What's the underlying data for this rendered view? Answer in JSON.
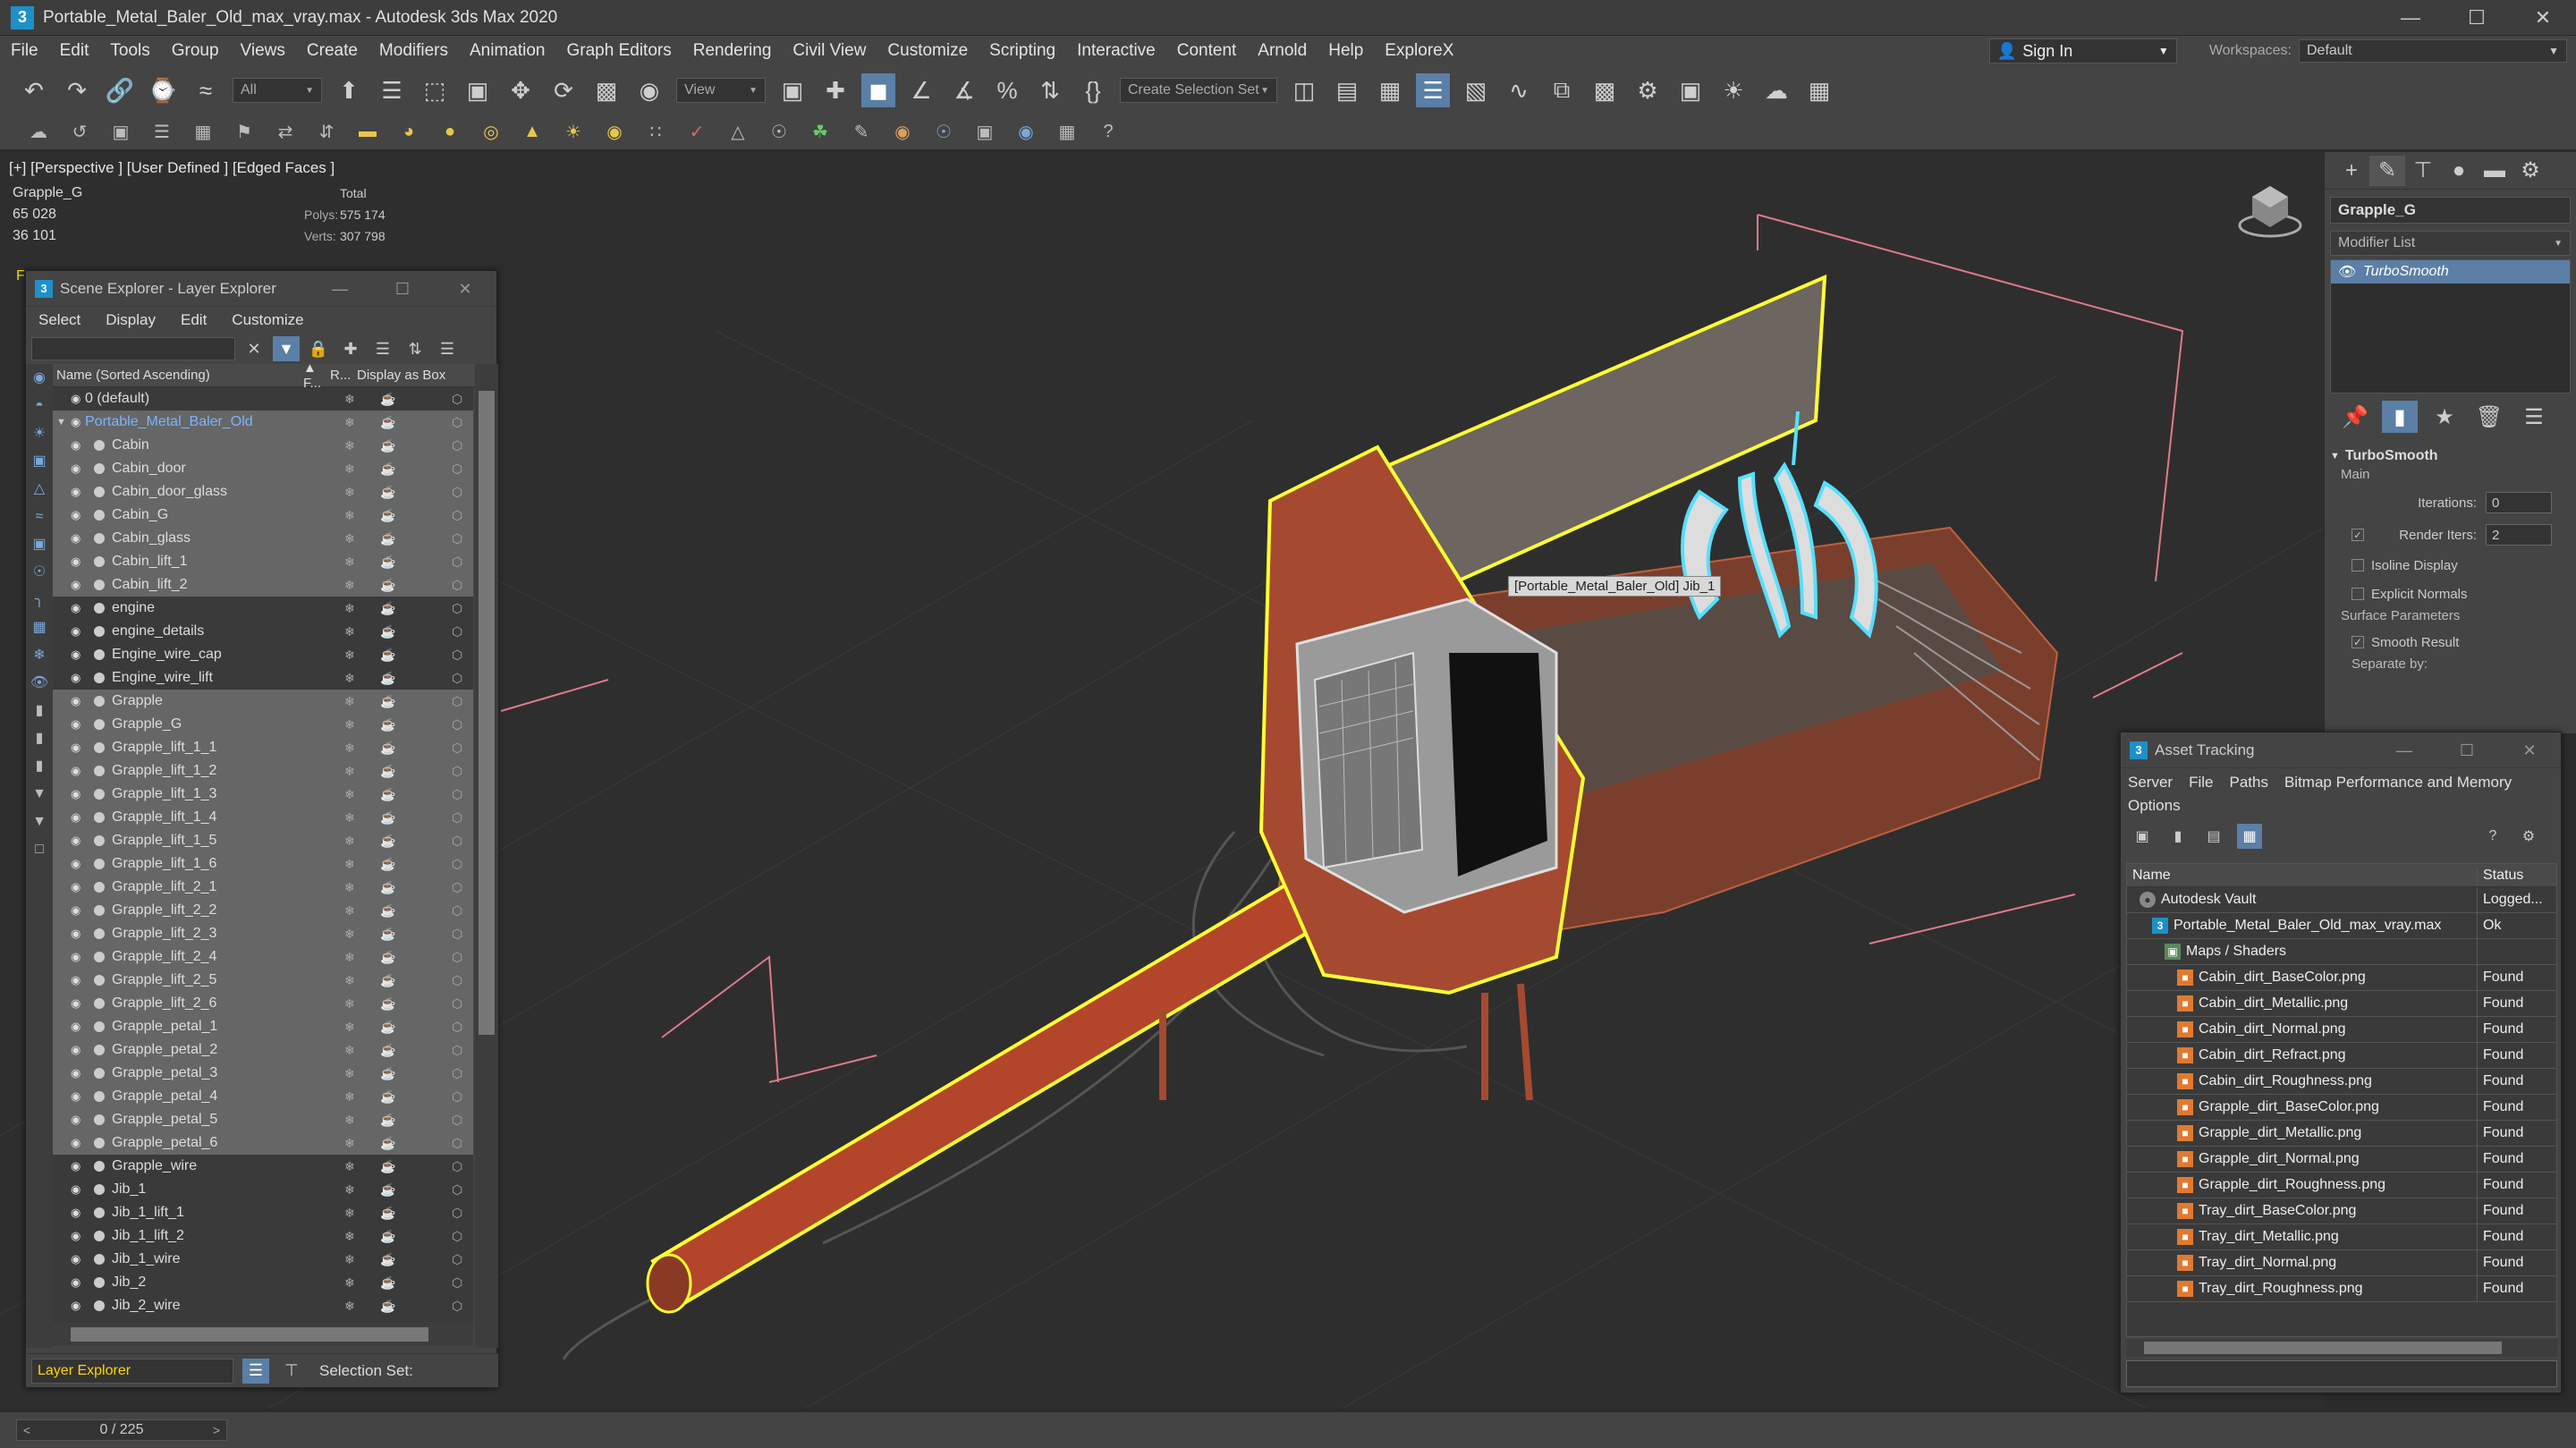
{
  "window": {
    "title": "Portable_Metal_Baler_Old_max_vray.max - Autodesk 3ds Max 2020",
    "app_icon": "3",
    "minimize_icon": "minimize-icon",
    "maximize_icon": "maximize-icon",
    "close_icon": "close-icon"
  },
  "menubar": {
    "items": [
      "File",
      "Edit",
      "Tools",
      "Group",
      "Views",
      "Create",
      "Modifiers",
      "Animation",
      "Graph Editors",
      "Rendering",
      "Civil View",
      "Customize",
      "Scripting",
      "Interactive",
      "Content",
      "Arnold",
      "Help",
      "ExploreX"
    ],
    "sign_in": "Sign In",
    "workspaces_label": "Workspaces:",
    "workspaces_value": "Default"
  },
  "toolbar": {
    "filter_all": "All",
    "ref_coord": "View",
    "selection_set": "Create Selection Set"
  },
  "viewport": {
    "label": "[+] [Perspective ] [User Defined ] [Edged Faces ]",
    "stats": {
      "col_total": "Total",
      "col_object": "Grapple_G",
      "polys_label": "Polys:",
      "polys_total": "575 174",
      "polys_object": "65 028",
      "verts_label": "Verts:",
      "verts_total": "307 798",
      "verts_object": "36 101"
    },
    "tooltip": "[Portable_Metal_Baler_Old] Jib_1",
    "edge_marker": "F",
    "colors": {
      "selection": "#ffff33",
      "highlight": "#55e0ff",
      "rust": "#b3452a"
    }
  },
  "command_panel": {
    "object_name": "Grapple_G",
    "modifier_list": "Modifier List",
    "stack_item": "TurboSmooth",
    "rollout_title": "TurboSmooth",
    "main_label": "Main",
    "iterations_label": "Iterations:",
    "iterations_value": "0",
    "render_iters_label": "Render Iters:",
    "render_iters_value": "2",
    "isoline_display": "Isoline Display",
    "explicit_normals": "Explicit Normals",
    "surface_params": "Surface Parameters",
    "smooth_result": "Smooth Result",
    "separate_by": "Separate by:"
  },
  "scene_explorer": {
    "title": "Scene Explorer - Layer Explorer",
    "menu": [
      "Select",
      "Display",
      "Edit",
      "Customize"
    ],
    "col_name": "Name (Sorted Ascending)",
    "col_f": "▲ F...",
    "col_r": "R...",
    "col_display": "Display as Box",
    "rows": [
      {
        "name": "0 (default)",
        "kind": "top",
        "sel": false
      },
      {
        "name": "Portable_Metal_Baler_Old",
        "kind": "layer",
        "sel": true
      },
      {
        "name": "Cabin",
        "kind": "obj",
        "sel": true
      },
      {
        "name": "Cabin_door",
        "kind": "obj",
        "sel": true
      },
      {
        "name": "Cabin_door_glass",
        "kind": "obj",
        "sel": true
      },
      {
        "name": "Cabin_G",
        "kind": "obj",
        "sel": true
      },
      {
        "name": "Cabin_glass",
        "kind": "obj",
        "sel": true
      },
      {
        "name": "Cabin_lift_1",
        "kind": "obj",
        "sel": true
      },
      {
        "name": "Cabin_lift_2",
        "kind": "obj",
        "sel": true
      },
      {
        "name": "engine",
        "kind": "obj",
        "sel": false
      },
      {
        "name": "engine_details",
        "kind": "obj",
        "sel": false
      },
      {
        "name": "Engine_wire_cap",
        "kind": "obj",
        "sel": false
      },
      {
        "name": "Engine_wire_lift",
        "kind": "obj",
        "sel": false
      },
      {
        "name": "Grapple",
        "kind": "obj",
        "sel": true
      },
      {
        "name": "Grapple_G",
        "kind": "obj",
        "sel": true
      },
      {
        "name": "Grapple_lift_1_1",
        "kind": "obj",
        "sel": true
      },
      {
        "name": "Grapple_lift_1_2",
        "kind": "obj",
        "sel": true
      },
      {
        "name": "Grapple_lift_1_3",
        "kind": "obj",
        "sel": true
      },
      {
        "name": "Grapple_lift_1_4",
        "kind": "obj",
        "sel": true
      },
      {
        "name": "Grapple_lift_1_5",
        "kind": "obj",
        "sel": true
      },
      {
        "name": "Grapple_lift_1_6",
        "kind": "obj",
        "sel": true
      },
      {
        "name": "Grapple_lift_2_1",
        "kind": "obj",
        "sel": true
      },
      {
        "name": "Grapple_lift_2_2",
        "kind": "obj",
        "sel": true
      },
      {
        "name": "Grapple_lift_2_3",
        "kind": "obj",
        "sel": true
      },
      {
        "name": "Grapple_lift_2_4",
        "kind": "obj",
        "sel": true
      },
      {
        "name": "Grapple_lift_2_5",
        "kind": "obj",
        "sel": true
      },
      {
        "name": "Grapple_lift_2_6",
        "kind": "obj",
        "sel": true
      },
      {
        "name": "Grapple_petal_1",
        "kind": "obj",
        "sel": true
      },
      {
        "name": "Grapple_petal_2",
        "kind": "obj",
        "sel": true
      },
      {
        "name": "Grapple_petal_3",
        "kind": "obj",
        "sel": true
      },
      {
        "name": "Grapple_petal_4",
        "kind": "obj",
        "sel": true
      },
      {
        "name": "Grapple_petal_5",
        "kind": "obj",
        "sel": true
      },
      {
        "name": "Grapple_petal_6",
        "kind": "obj",
        "sel": true
      },
      {
        "name": "Grapple_wire",
        "kind": "obj",
        "sel": false
      },
      {
        "name": "Jib_1",
        "kind": "obj",
        "sel": false
      },
      {
        "name": "Jib_1_lift_1",
        "kind": "obj",
        "sel": false
      },
      {
        "name": "Jib_1_lift_2",
        "kind": "obj",
        "sel": false
      },
      {
        "name": "Jib_1_wire",
        "kind": "obj",
        "sel": false
      },
      {
        "name": "Jib_2",
        "kind": "obj",
        "sel": false
      },
      {
        "name": "Jib_2_wire",
        "kind": "obj",
        "sel": false
      }
    ],
    "footer_explorer": "Layer Explorer",
    "footer_selection_set": "Selection Set:"
  },
  "asset_tracking": {
    "title": "Asset Tracking",
    "menu": [
      "Server",
      "File",
      "Paths",
      "Bitmap Performance and Memory"
    ],
    "menu2": "Options",
    "col_name": "Name",
    "col_status": "Status",
    "rows": [
      {
        "name": "Autodesk Vault",
        "status": "Logged...",
        "indent": 1,
        "icon": "vault"
      },
      {
        "name": "Portable_Metal_Baler_Old_max_vray.max",
        "status": "Ok",
        "indent": 2,
        "icon": "max"
      },
      {
        "name": "Maps / Shaders",
        "status": "",
        "indent": 3,
        "icon": "maps"
      },
      {
        "name": "Cabin_dirt_BaseColor.png",
        "status": "Found",
        "indent": 4,
        "icon": "png"
      },
      {
        "name": "Cabin_dirt_Metallic.png",
        "status": "Found",
        "indent": 4,
        "icon": "png"
      },
      {
        "name": "Cabin_dirt_Normal.png",
        "status": "Found",
        "indent": 4,
        "icon": "png"
      },
      {
        "name": "Cabin_dirt_Refract.png",
        "status": "Found",
        "indent": 4,
        "icon": "png"
      },
      {
        "name": "Cabin_dirt_Roughness.png",
        "status": "Found",
        "indent": 4,
        "icon": "png"
      },
      {
        "name": "Grapple_dirt_BaseColor.png",
        "status": "Found",
        "indent": 4,
        "icon": "png"
      },
      {
        "name": "Grapple_dirt_Metallic.png",
        "status": "Found",
        "indent": 4,
        "icon": "png"
      },
      {
        "name": "Grapple_dirt_Normal.png",
        "status": "Found",
        "indent": 4,
        "icon": "png"
      },
      {
        "name": "Grapple_dirt_Roughness.png",
        "status": "Found",
        "indent": 4,
        "icon": "png"
      },
      {
        "name": "Tray_dirt_BaseColor.png",
        "status": "Found",
        "indent": 4,
        "icon": "png"
      },
      {
        "name": "Tray_dirt_Metallic.png",
        "status": "Found",
        "indent": 4,
        "icon": "png"
      },
      {
        "name": "Tray_dirt_Normal.png",
        "status": "Found",
        "indent": 4,
        "icon": "png"
      },
      {
        "name": "Tray_dirt_Roughness.png",
        "status": "Found",
        "indent": 4,
        "icon": "png"
      }
    ]
  },
  "statusbar": {
    "time_slider": "0 / 225"
  }
}
